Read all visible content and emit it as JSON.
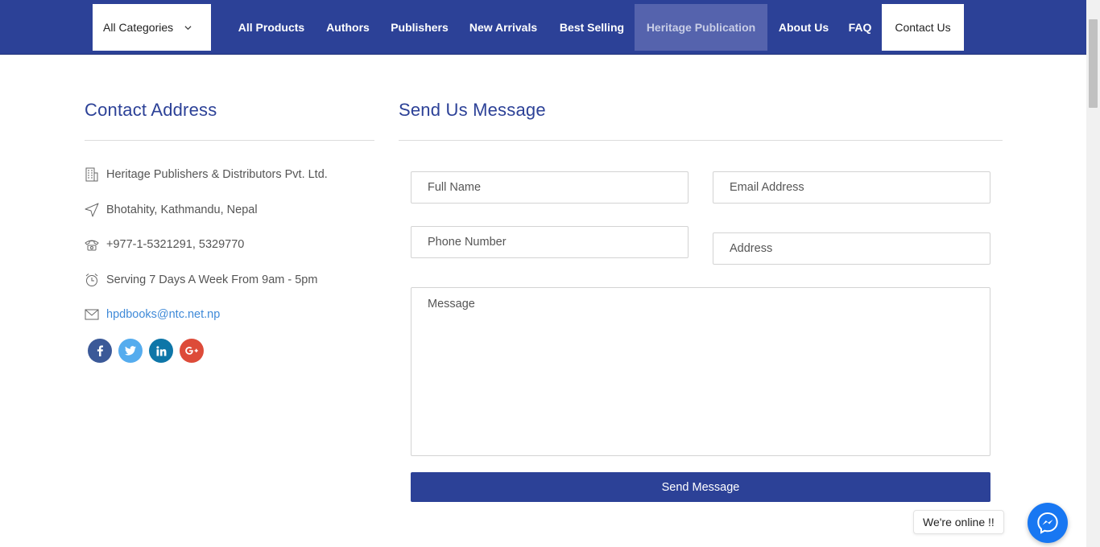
{
  "nav": {
    "category_dropdown": "All Categories",
    "items": [
      "All Products",
      "Authors",
      "Publishers",
      "New Arrivals",
      "Best Selling",
      "Heritage Publication",
      "About Us",
      "FAQ",
      "Contact Us"
    ],
    "highlight_color": "#5563ad",
    "bar_color": "#2c4197"
  },
  "contact": {
    "title": "Contact Address",
    "company": "Heritage Publishers & Distributors Pvt. Ltd.",
    "address": "Bhotahity, Kathmandu, Nepal",
    "phone": "+977-1-5321291, 5329770",
    "hours": "Serving 7 Days A Week From 9am - 5pm",
    "email": "hpdbooks@ntc.net.np",
    "social": [
      {
        "icon": "facebook-icon",
        "glyph": "f",
        "color": "#3b5998"
      },
      {
        "icon": "twitter-icon",
        "glyph": "t",
        "color": "#55acee"
      },
      {
        "icon": "linkedin-icon",
        "glyph": "in",
        "color": "#0e76a8"
      },
      {
        "icon": "google-plus-icon",
        "glyph": "G+",
        "color": "#dd4b39"
      }
    ]
  },
  "form": {
    "title": "Send Us Message",
    "full_name_placeholder": "Full Name",
    "email_placeholder": "Email Address",
    "phone_placeholder": "Phone Number",
    "address_placeholder": "Address",
    "message_placeholder": "Message",
    "submit_label": "Send Message"
  },
  "chat": {
    "status_text": "We're online !!",
    "icon": "messenger-icon"
  }
}
